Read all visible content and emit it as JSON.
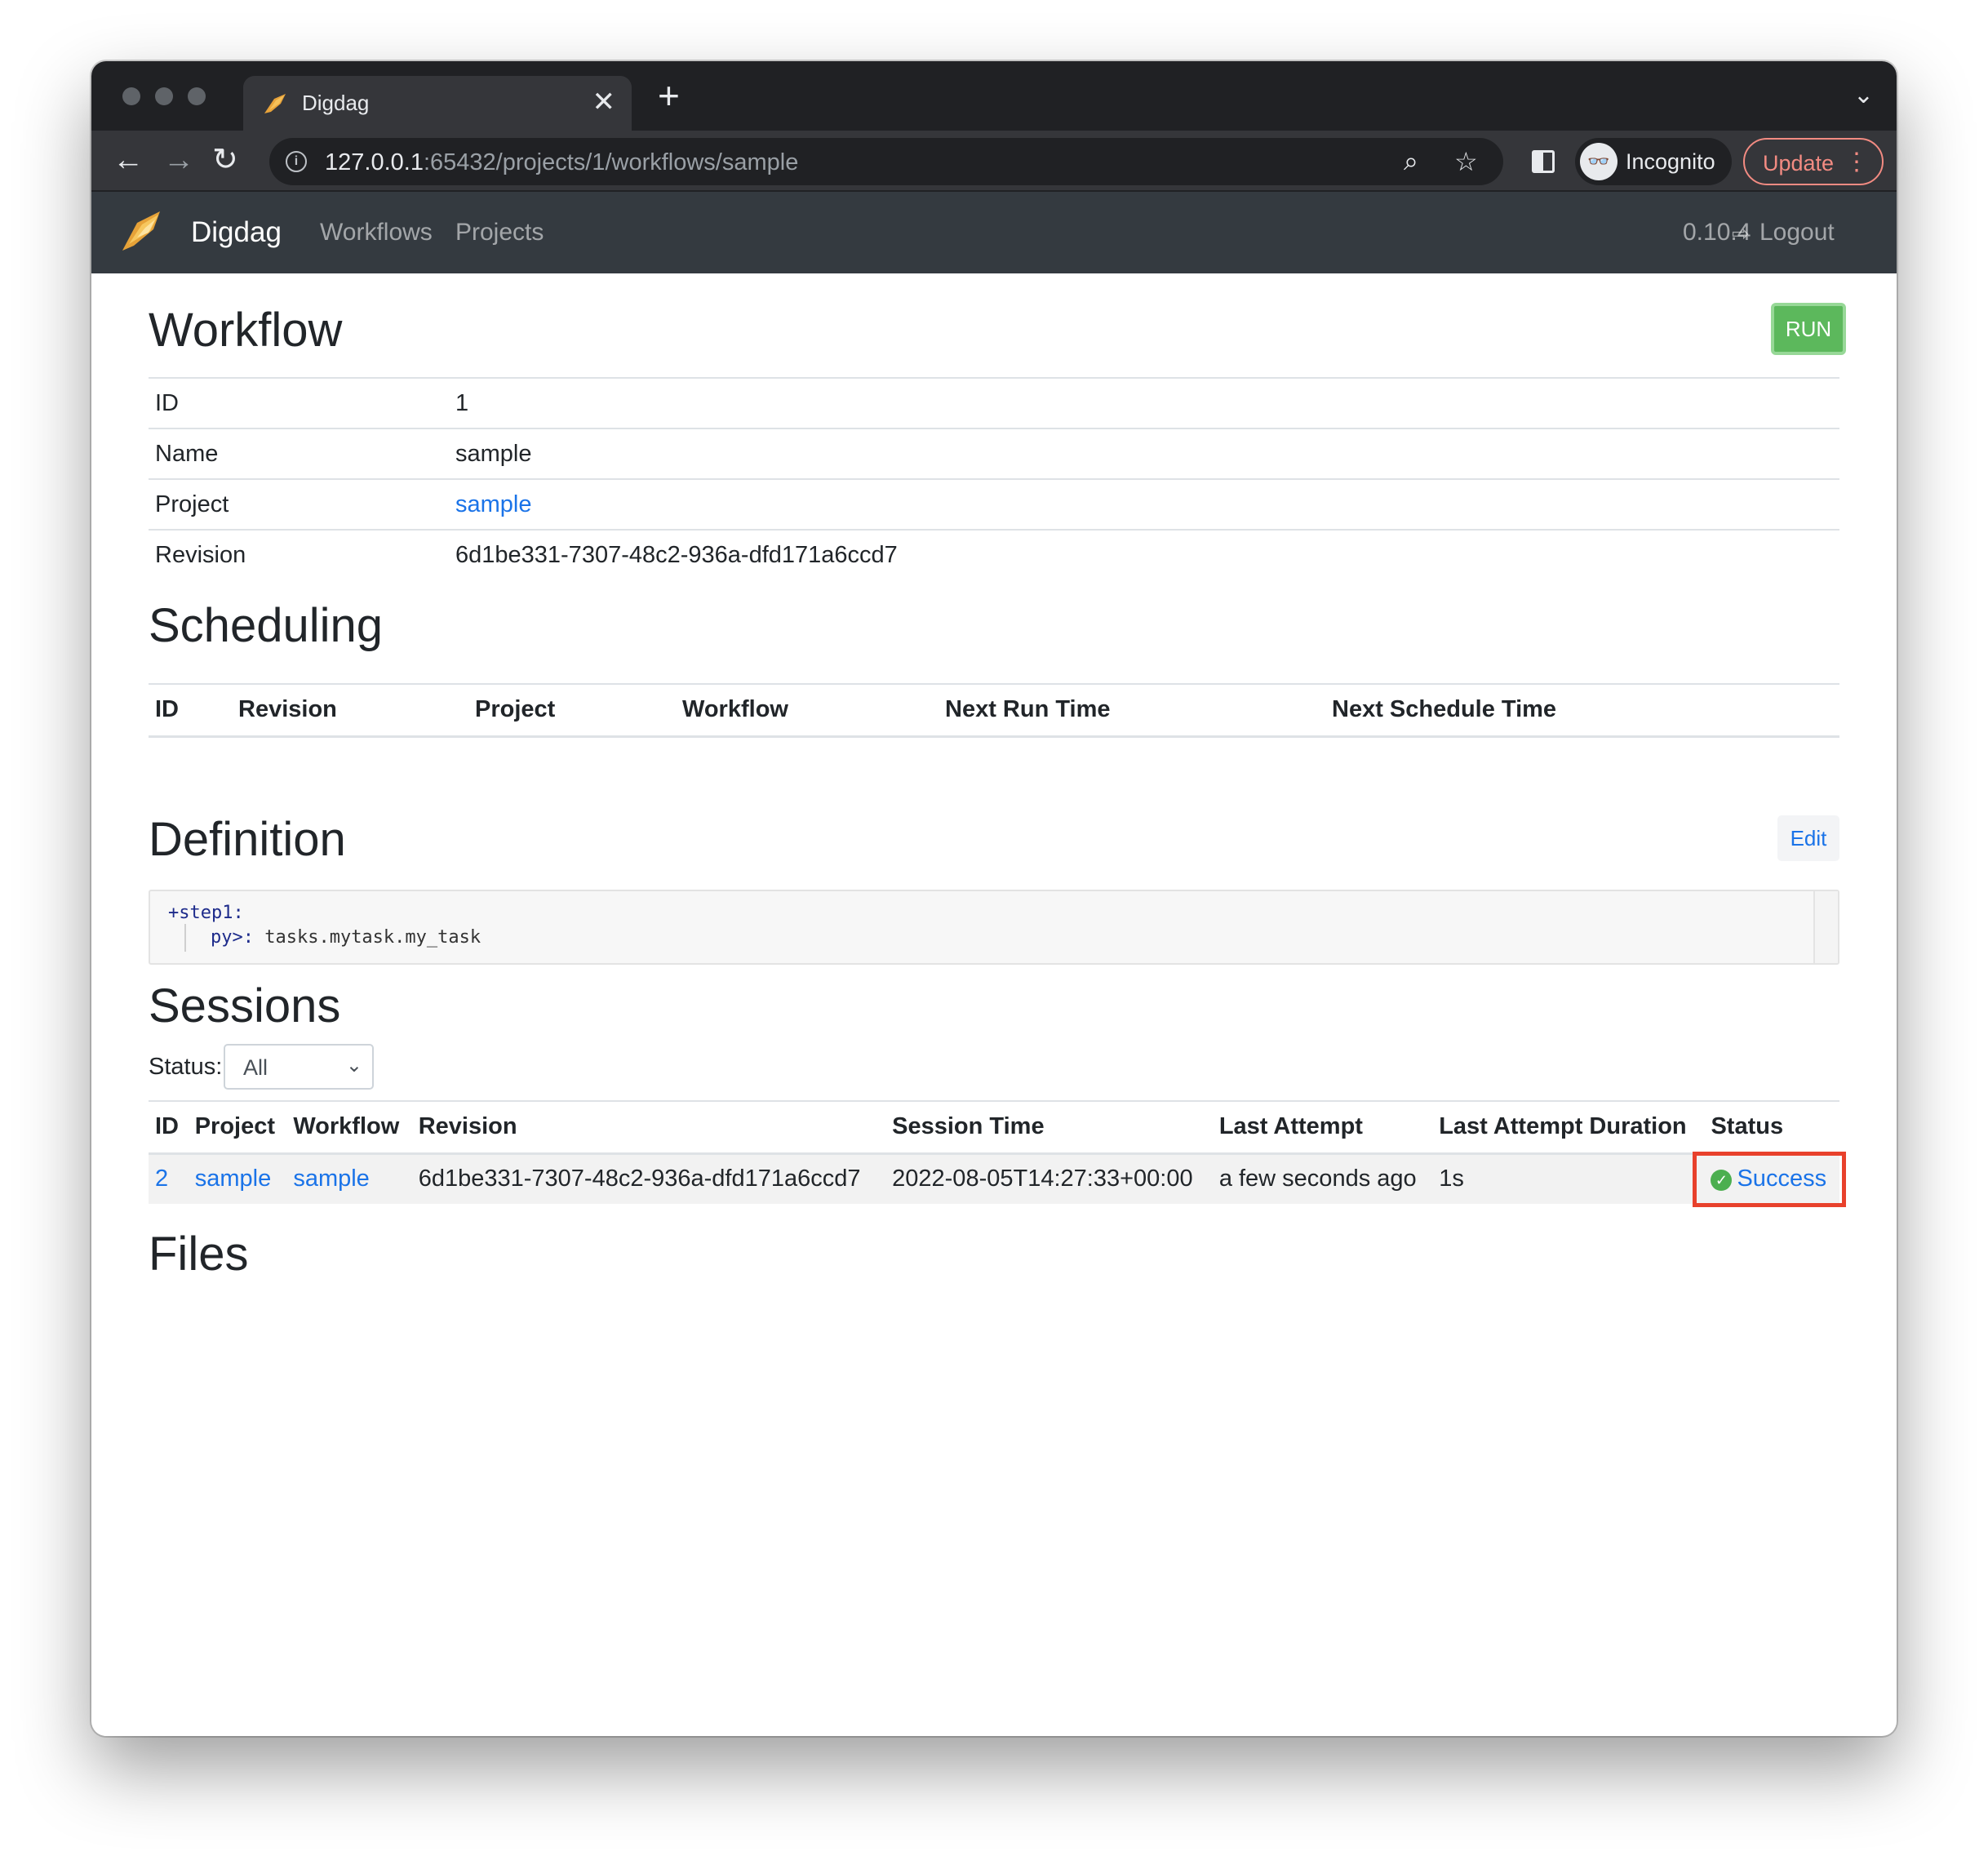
{
  "browser": {
    "tab_title": "Digdag",
    "tab_close": "✕",
    "new_tab": "+",
    "tab_search": "⌄",
    "back": "←",
    "forward": "→",
    "reload": "↻",
    "url_host": "127.0.0.1",
    "url_path": ":65432/projects/1/workflows/sample",
    "zoom_icon": "⌕",
    "star_icon": "☆",
    "incognito_label": "Incognito",
    "incognito_icon": "👓",
    "update_label": "Update",
    "menu_icon": "⋮"
  },
  "navbar": {
    "brand": "Digdag",
    "links": [
      "Workflows",
      "Projects"
    ],
    "version": "0.10.4",
    "logout_icon": "⇨",
    "logout": "Logout"
  },
  "workflow": {
    "title": "Workflow",
    "run_label": "RUN",
    "rows": [
      {
        "key": "ID",
        "value": "1"
      },
      {
        "key": "Name",
        "value": "sample"
      },
      {
        "key": "Project",
        "value": "sample"
      },
      {
        "key": "Revision",
        "value": "6d1be331-7307-48c2-936a-dfd171a6ccd7"
      }
    ]
  },
  "scheduling": {
    "title": "Scheduling",
    "columns": [
      "ID",
      "Revision",
      "Project",
      "Workflow",
      "Next Run Time",
      "Next Schedule Time"
    ]
  },
  "definition": {
    "title": "Definition",
    "edit_label": "Edit",
    "line1_key": "+step1:",
    "line2_key": "py>:",
    "line2_value": " tasks.mytask.my_task"
  },
  "sessions": {
    "title": "Sessions",
    "status_label": "Status:",
    "status_value": "All",
    "columns": [
      "ID",
      "Project",
      "Workflow",
      "Revision",
      "Session Time",
      "Last Attempt",
      "Last Attempt Duration",
      "Status"
    ],
    "rows": [
      {
        "id": "2",
        "project": "sample",
        "workflow": "sample",
        "revision": "6d1be331-7307-48c2-936a-dfd171a6ccd7",
        "session_time": "2022-08-05T14:27:33+00:00",
        "last_attempt": "a few seconds ago",
        "duration": "1s",
        "status": "Success"
      }
    ]
  },
  "files": {
    "title": "Files"
  },
  "colors": {
    "navbar_bg": "#343a40",
    "link": "#1a73e8",
    "run_button": "#5cb85c",
    "success": "#4caf50",
    "highlight": "#e8412c"
  }
}
